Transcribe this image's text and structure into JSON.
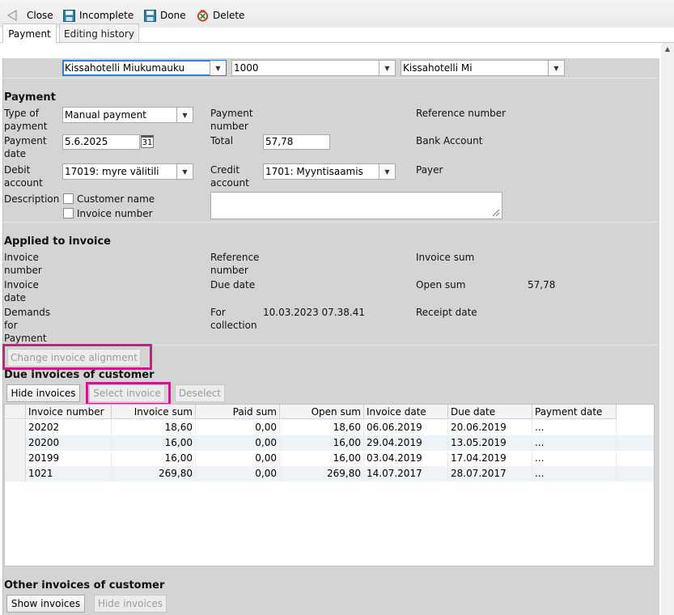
{
  "toolbar": {
    "close_label": "Close",
    "incomplete_label": "Incomplete",
    "done_label": "Done",
    "delete_label": "Delete"
  },
  "tabs": [
    {
      "label": "Payment",
      "active": true
    },
    {
      "label": "Editing history",
      "active": false
    }
  ],
  "top_selects": {
    "hotel": "Kissahotelli Miukumauku",
    "code": "1000",
    "short_name": "Kissahotelli Mi"
  },
  "payment": {
    "section_title": "Payment",
    "type_label": "Type of payment",
    "type_value": "Manual payment",
    "payment_number_label": "Payment number",
    "reference_number_label": "Reference number",
    "date_label": "Payment date",
    "date_value": "5.6.2025",
    "calendar_text": "31",
    "total_label": "Total",
    "total_value": "57,78",
    "bank_account_label": "Bank Account",
    "debit_label": "Debit account",
    "debit_value": "17019: myre välitili",
    "credit_label": "Credit account",
    "credit_value": "1701: Myyntisaamis",
    "payer_label": "Payer",
    "description_label": "Description",
    "customer_name_label": "Customer name",
    "invoice_number_chk_label": "Invoice number"
  },
  "applied": {
    "section_title": "Applied to invoice",
    "invoice_number_label": "Invoice number",
    "reference_number_label": "Reference number",
    "invoice_sum_label": "Invoice sum",
    "invoice_date_label": "Invoice date",
    "due_date_label": "Due date",
    "open_sum_label": "Open sum",
    "open_sum_value": "57,78",
    "demands_label": "Demands for Payment",
    "for_collection_label": "For collection",
    "for_collection_value": "10.03.2023 07.38.41",
    "receipt_date_label": "Receipt date",
    "change_alignment_button": "Change invoice alignment"
  },
  "due_invoices": {
    "section_title": "Due invoices of customer",
    "hide_button": "Hide invoices",
    "select_button": "Select invoice",
    "deselect_button": "Deselect",
    "columns": [
      "Invoice number",
      "Invoice sum",
      "Paid sum",
      "Open sum",
      "Invoice date",
      "Due date",
      "Payment date"
    ],
    "rows": [
      {
        "number": "20202",
        "sum": "18,60",
        "paid": "0,00",
        "open": "18,60",
        "invoice_date": "06.06.2019",
        "due_date": "20.06.2019",
        "payment_date": "..."
      },
      {
        "number": "20200",
        "sum": "16,00",
        "paid": "0,00",
        "open": "16,00",
        "invoice_date": "29.04.2019",
        "due_date": "13.05.2019",
        "payment_date": "..."
      },
      {
        "number": "20199",
        "sum": "16,00",
        "paid": "0,00",
        "open": "16,00",
        "invoice_date": "03.04.2019",
        "due_date": "17.04.2019",
        "payment_date": "..."
      },
      {
        "number": "1021",
        "sum": "269,80",
        "paid": "0,00",
        "open": "269,80",
        "invoice_date": "14.07.2017",
        "due_date": "28.07.2017",
        "payment_date": "..."
      }
    ]
  },
  "other_invoices": {
    "section_title": "Other invoices of customer",
    "show_button": "Show invoices",
    "hide_button": "Hide invoices"
  },
  "colors": {
    "highlight": "#cc1a8a",
    "panel": "#d4d4d4",
    "save_icon": "#2e7ea6",
    "delete_icon": "#c0392b"
  }
}
